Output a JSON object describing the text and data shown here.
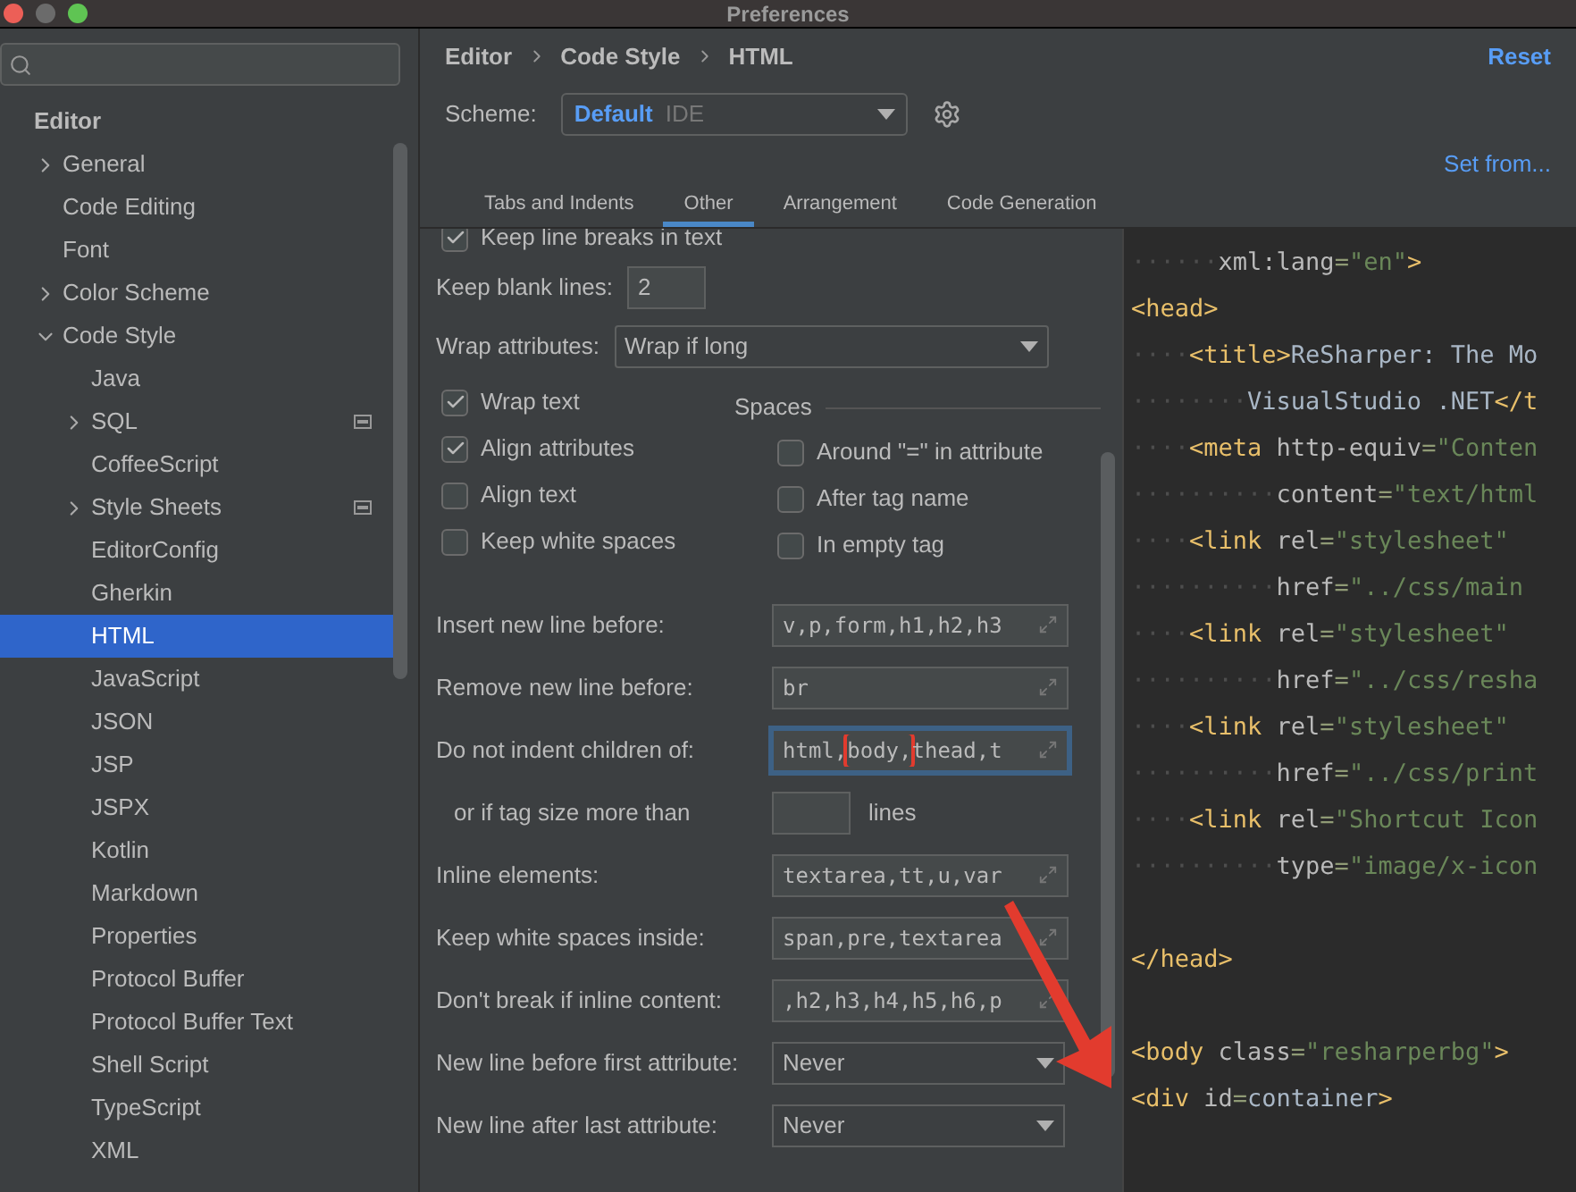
{
  "window": {
    "title": "Preferences"
  },
  "sidebar": {
    "section": "Editor",
    "items": [
      {
        "label": "General",
        "expandable": true,
        "expanded": false,
        "selected": false,
        "scheme_badge": false
      },
      {
        "label": "Code Editing",
        "expandable": false,
        "expanded": false,
        "selected": false,
        "scheme_badge": false
      },
      {
        "label": "Font",
        "expandable": false,
        "expanded": false,
        "selected": false,
        "scheme_badge": false
      },
      {
        "label": "Color Scheme",
        "expandable": true,
        "expanded": false,
        "selected": false,
        "scheme_badge": false
      },
      {
        "label": "Code Style",
        "expandable": true,
        "expanded": true,
        "selected": false,
        "scheme_badge": false,
        "children": [
          {
            "label": "Java",
            "expandable": false,
            "expanded": false,
            "selected": false,
            "scheme_badge": false
          },
          {
            "label": "SQL",
            "expandable": true,
            "expanded": false,
            "selected": false,
            "scheme_badge": true
          },
          {
            "label": "CoffeeScript",
            "expandable": false,
            "expanded": false,
            "selected": false,
            "scheme_badge": false
          },
          {
            "label": "Style Sheets",
            "expandable": true,
            "expanded": false,
            "selected": false,
            "scheme_badge": true
          },
          {
            "label": "EditorConfig",
            "expandable": false,
            "expanded": false,
            "selected": false,
            "scheme_badge": false
          },
          {
            "label": "Gherkin",
            "expandable": false,
            "expanded": false,
            "selected": false,
            "scheme_badge": false
          },
          {
            "label": "HTML",
            "expandable": false,
            "expanded": false,
            "selected": true,
            "scheme_badge": false
          },
          {
            "label": "JavaScript",
            "expandable": false,
            "expanded": false,
            "selected": false,
            "scheme_badge": false
          },
          {
            "label": "JSON",
            "expandable": false,
            "expanded": false,
            "selected": false,
            "scheme_badge": false
          },
          {
            "label": "JSP",
            "expandable": false,
            "expanded": false,
            "selected": false,
            "scheme_badge": false
          },
          {
            "label": "JSPX",
            "expandable": false,
            "expanded": false,
            "selected": false,
            "scheme_badge": false
          },
          {
            "label": "Kotlin",
            "expandable": false,
            "expanded": false,
            "selected": false,
            "scheme_badge": false
          },
          {
            "label": "Markdown",
            "expandable": false,
            "expanded": false,
            "selected": false,
            "scheme_badge": false
          },
          {
            "label": "Properties",
            "expandable": false,
            "expanded": false,
            "selected": false,
            "scheme_badge": false
          },
          {
            "label": "Protocol Buffer",
            "expandable": false,
            "expanded": false,
            "selected": false,
            "scheme_badge": false
          },
          {
            "label": "Protocol Buffer Text",
            "expandable": false,
            "expanded": false,
            "selected": false,
            "scheme_badge": false
          },
          {
            "label": "Shell Script",
            "expandable": false,
            "expanded": false,
            "selected": false,
            "scheme_badge": false
          },
          {
            "label": "TypeScript",
            "expandable": false,
            "expanded": false,
            "selected": false,
            "scheme_badge": false
          },
          {
            "label": "XML",
            "expandable": false,
            "expanded": false,
            "selected": false,
            "scheme_badge": false
          }
        ]
      }
    ]
  },
  "header": {
    "breadcrumb": [
      "Editor",
      "Code Style",
      "HTML"
    ],
    "reset": "Reset",
    "scheme_label": "Scheme:",
    "scheme_name": "Default",
    "scheme_kind": "IDE",
    "set_from": "Set from..."
  },
  "tabs": [
    {
      "label": "Tabs and Indents",
      "selected": false
    },
    {
      "label": "Other",
      "selected": true
    },
    {
      "label": "Arrangement",
      "selected": false
    },
    {
      "label": "Code Generation",
      "selected": false
    }
  ],
  "top_checkbox": {
    "label": "Keep line breaks in text",
    "checked": true
  },
  "keep_blank_lines": {
    "label": "Keep blank lines:",
    "value": "2"
  },
  "wrap_attributes": {
    "label": "Wrap attributes:",
    "value": "Wrap if long"
  },
  "left_checkboxes": [
    {
      "label": "Wrap text",
      "checked": true
    },
    {
      "label": "Align attributes",
      "checked": true
    },
    {
      "label": "Align text",
      "checked": false
    },
    {
      "label": "Keep white spaces",
      "checked": false
    }
  ],
  "spaces": {
    "title": "Spaces",
    "checkboxes": [
      {
        "label": "Around \"=\" in attribute",
        "checked": false
      },
      {
        "label": "After tag name",
        "checked": false
      },
      {
        "label": "In empty tag",
        "checked": false
      }
    ]
  },
  "fields": [
    {
      "kind": "expand",
      "label": "Insert new line before:",
      "focused": false,
      "parts": [
        {
          "text": "v,p,form,h1,h2,h3",
          "annotated": false
        }
      ]
    },
    {
      "kind": "expand",
      "label": "Remove new line before:",
      "focused": false,
      "parts": [
        {
          "text": "br",
          "annotated": false
        }
      ]
    },
    {
      "kind": "expand",
      "label": "Do not indent children of:",
      "focused": true,
      "parts": [
        {
          "text": "html,",
          "annotated": false
        },
        {
          "text": "body,",
          "annotated": true
        },
        {
          "text": "thead,t",
          "annotated": false
        }
      ]
    },
    {
      "kind": "number",
      "label": "or if tag size more than",
      "suffix": "lines"
    },
    {
      "kind": "expand",
      "label": "Inline elements:",
      "focused": false,
      "parts": [
        {
          "text": "textarea,tt,u,var",
          "annotated": false
        }
      ]
    },
    {
      "kind": "expand",
      "label": "Keep white spaces inside:",
      "focused": false,
      "parts": [
        {
          "text": "span,pre,textarea",
          "annotated": false
        }
      ]
    },
    {
      "kind": "expand",
      "label": "Don't break if inline content:",
      "focused": false,
      "parts": [
        {
          "text": ",h2,h3,h4,h5,h6,p",
          "annotated": false
        }
      ]
    },
    {
      "kind": "select",
      "label": "New line before first attribute:",
      "value": "Never"
    },
    {
      "kind": "select",
      "label": "New line after last attribute:",
      "value": "Never"
    }
  ],
  "preview": {
    "lines": [
      {
        "kind": "code",
        "tokens": [
          {
            "kind": "ws",
            "text": "······"
          },
          {
            "kind": "attr",
            "text": "xml:lang"
          },
          {
            "kind": "eq",
            "text": "="
          },
          {
            "kind": "value",
            "text": "\"en\""
          },
          {
            "kind": "tag",
            "text": ">"
          }
        ]
      },
      {
        "kind": "code",
        "tokens": [
          {
            "kind": "tag",
            "text": "<head>"
          }
        ]
      },
      {
        "kind": "code",
        "tokens": [
          {
            "kind": "ws",
            "text": "····"
          },
          {
            "kind": "tag",
            "text": "<title>"
          },
          {
            "kind": "text",
            "text": "ReSharper: The Mo"
          }
        ]
      },
      {
        "kind": "code",
        "tokens": [
          {
            "kind": "ws",
            "text": "········"
          },
          {
            "kind": "text",
            "text": "VisualStudio .NET"
          },
          {
            "kind": "tag",
            "text": "</t"
          }
        ]
      },
      {
        "kind": "code",
        "tokens": [
          {
            "kind": "ws",
            "text": "····"
          },
          {
            "kind": "tag",
            "text": "<meta"
          },
          {
            "kind": "attr",
            "text": "http-equiv"
          },
          {
            "kind": "eq",
            "text": "="
          },
          {
            "kind": "value",
            "text": "\"Conten"
          }
        ]
      },
      {
        "kind": "code",
        "tokens": [
          {
            "kind": "ws",
            "text": "··········"
          },
          {
            "kind": "attr",
            "text": "content"
          },
          {
            "kind": "eq",
            "text": "="
          },
          {
            "kind": "value",
            "text": "\"text/html"
          }
        ]
      },
      {
        "kind": "code",
        "tokens": [
          {
            "kind": "ws",
            "text": "····"
          },
          {
            "kind": "tag",
            "text": "<link"
          },
          {
            "kind": "attr",
            "text": "rel"
          },
          {
            "kind": "eq",
            "text": "="
          },
          {
            "kind": "value",
            "text": "\"stylesheet\""
          }
        ]
      },
      {
        "kind": "code",
        "tokens": [
          {
            "kind": "ws",
            "text": "··········"
          },
          {
            "kind": "attr",
            "text": "href"
          },
          {
            "kind": "eq",
            "text": "="
          },
          {
            "kind": "value",
            "text": "\"../css/main"
          }
        ]
      },
      {
        "kind": "code",
        "tokens": [
          {
            "kind": "ws",
            "text": "····"
          },
          {
            "kind": "tag",
            "text": "<link"
          },
          {
            "kind": "attr",
            "text": "rel"
          },
          {
            "kind": "eq",
            "text": "="
          },
          {
            "kind": "value",
            "text": "\"stylesheet\""
          }
        ]
      },
      {
        "kind": "code",
        "tokens": [
          {
            "kind": "ws",
            "text": "··········"
          },
          {
            "kind": "attr",
            "text": "href"
          },
          {
            "kind": "eq",
            "text": "="
          },
          {
            "kind": "value",
            "text": "\"../css/resha"
          }
        ]
      },
      {
        "kind": "code",
        "tokens": [
          {
            "kind": "ws",
            "text": "····"
          },
          {
            "kind": "tag",
            "text": "<link"
          },
          {
            "kind": "attr",
            "text": "rel"
          },
          {
            "kind": "eq",
            "text": "="
          },
          {
            "kind": "value",
            "text": "\"stylesheet\""
          }
        ]
      },
      {
        "kind": "code",
        "tokens": [
          {
            "kind": "ws",
            "text": "··········"
          },
          {
            "kind": "attr",
            "text": "href"
          },
          {
            "kind": "eq",
            "text": "="
          },
          {
            "kind": "value",
            "text": "\"../css/print"
          }
        ]
      },
      {
        "kind": "code",
        "tokens": [
          {
            "kind": "ws",
            "text": "····"
          },
          {
            "kind": "tag",
            "text": "<link"
          },
          {
            "kind": "attr",
            "text": "rel"
          },
          {
            "kind": "eq",
            "text": "="
          },
          {
            "kind": "value",
            "text": "\"Shortcut Icon"
          }
        ]
      },
      {
        "kind": "code",
        "tokens": [
          {
            "kind": "ws",
            "text": "··········"
          },
          {
            "kind": "attr",
            "text": "type"
          },
          {
            "kind": "eq",
            "text": "="
          },
          {
            "kind": "value",
            "text": "\"image/x-icon"
          }
        ]
      },
      {
        "kind": "blank"
      },
      {
        "kind": "code",
        "tokens": [
          {
            "kind": "tag",
            "text": "</head>"
          }
        ]
      },
      {
        "kind": "blank"
      },
      {
        "kind": "code",
        "tokens": [
          {
            "kind": "tag",
            "text": "<body"
          },
          {
            "kind": "attr",
            "text": "class"
          },
          {
            "kind": "eq",
            "text": "="
          },
          {
            "kind": "value",
            "text": "\"resharperbg\""
          },
          {
            "kind": "tag",
            "text": ">"
          }
        ]
      },
      {
        "kind": "code",
        "tokens": [
          {
            "kind": "tag",
            "text": "<div"
          },
          {
            "kind": "attr",
            "text": "id"
          },
          {
            "kind": "eq",
            "text": "="
          },
          {
            "kind": "text",
            "text": "container"
          },
          {
            "kind": "tag",
            "text": ">"
          }
        ]
      }
    ]
  }
}
